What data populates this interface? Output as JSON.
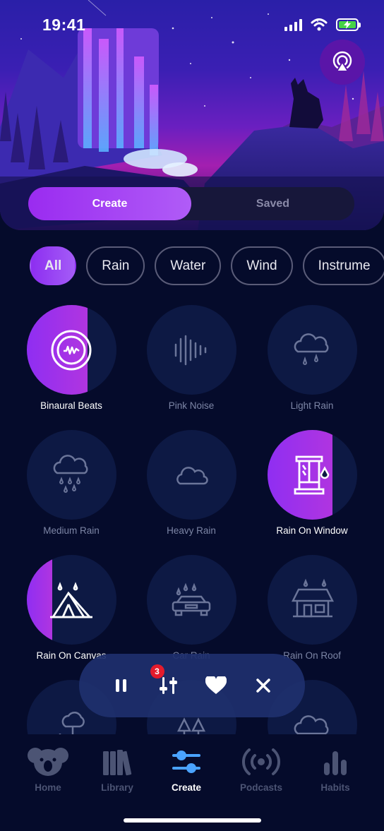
{
  "status_bar": {
    "time": "19:41"
  },
  "header": {
    "airplay_icon": "airplay-icon",
    "segments": [
      {
        "label": "Create",
        "active": true
      },
      {
        "label": "Saved",
        "active": false
      }
    ]
  },
  "filters": [
    {
      "label": "All",
      "active": true
    },
    {
      "label": "Rain"
    },
    {
      "label": "Water"
    },
    {
      "label": "Wind"
    },
    {
      "label": "Instrume"
    }
  ],
  "sounds": [
    {
      "label": "Binaural Beats",
      "icon": "waveform-circle-icon",
      "level": 0.68
    },
    {
      "label": "Pink Noise",
      "icon": "sound-wave-icon",
      "level": 0
    },
    {
      "label": "Light Rain",
      "icon": "light-rain-icon",
      "level": 0
    },
    {
      "label": "Medium Rain",
      "icon": "medium-rain-icon",
      "level": 0
    },
    {
      "label": "Heavy Rain",
      "icon": "cloud-icon",
      "level": 0
    },
    {
      "label": "Rain On Window",
      "icon": "window-rain-icon",
      "level": 0.73
    },
    {
      "label": "Rain On Canvas",
      "icon": "tent-rain-icon",
      "level": 0.29
    },
    {
      "label": "Car Rain",
      "icon": "car-rain-icon",
      "level": 0
    },
    {
      "label": "Rain On Roof",
      "icon": "roof-rain-icon",
      "level": 0
    }
  ],
  "mini_player": {
    "mixer_count": "3"
  },
  "tabs": [
    {
      "label": "Home",
      "icon": "koala-icon",
      "active": false
    },
    {
      "label": "Library",
      "icon": "library-icon",
      "active": false
    },
    {
      "label": "Create",
      "icon": "sliders-icon",
      "active": true
    },
    {
      "label": "Podcasts",
      "icon": "podcast-icon",
      "active": false
    },
    {
      "label": "Habits",
      "icon": "chart-bars-icon",
      "active": false
    }
  ],
  "colors": {
    "accent": "#9a2bf0",
    "background": "#050b2b",
    "circle": "#0d1944",
    "inactive_text": "#7d86a6"
  }
}
